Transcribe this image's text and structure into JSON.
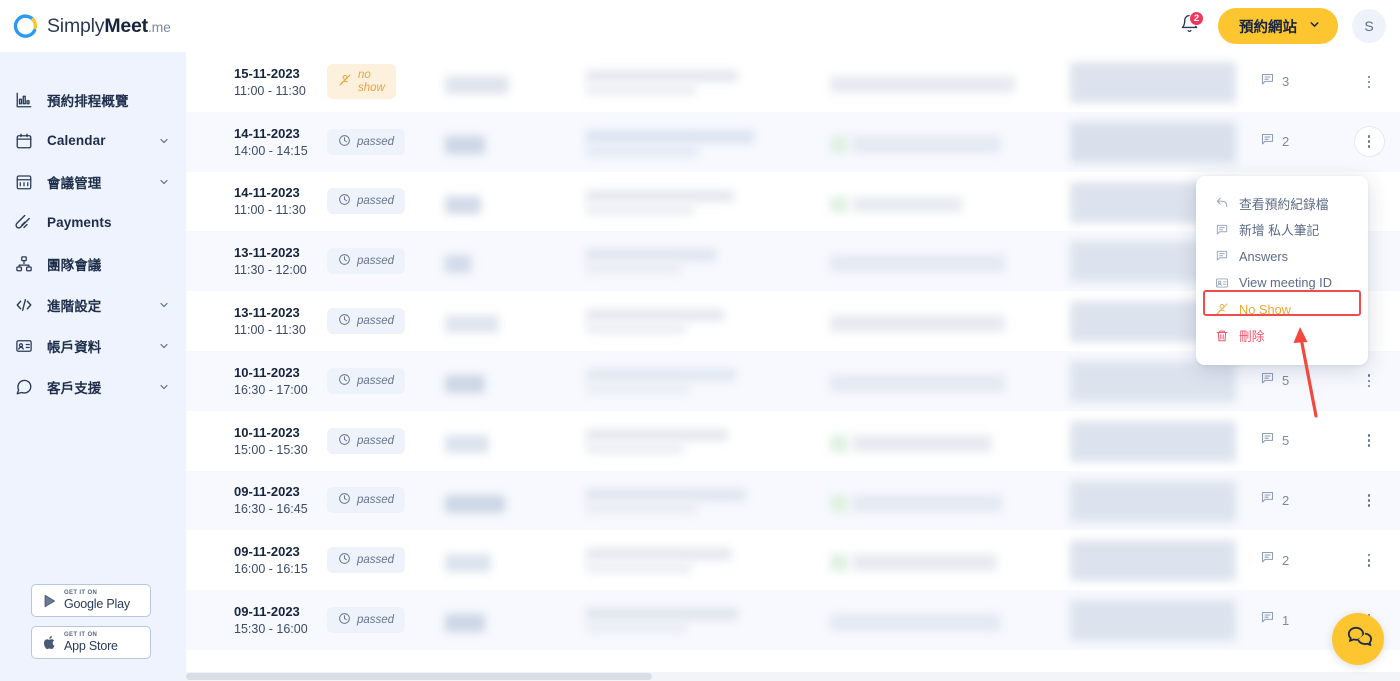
{
  "header": {
    "logo": {
      "simply": "Simply",
      "meet": "Meet",
      "me": ".me",
      "icon": "simplymeet-circle-logo"
    },
    "notifications": {
      "icon": "bell-icon",
      "badge": "2"
    },
    "cta": {
      "label": "預約網站",
      "chevron": "chevron-down-icon"
    },
    "avatar": {
      "initial": "S"
    }
  },
  "sidebar": {
    "items": [
      {
        "label": "預約排程概覽",
        "icon": "chart-bar-icon",
        "chevron": false
      },
      {
        "label": "Calendar",
        "icon": "calendar-icon",
        "chevron": true
      },
      {
        "label": "會議管理",
        "icon": "calendar-grid-icon",
        "chevron": true
      },
      {
        "label": "Payments",
        "icon": "payments-icon",
        "chevron": false
      },
      {
        "label": "團隊會議",
        "icon": "org-chart-icon",
        "chevron": false
      },
      {
        "label": "進階設定",
        "icon": "code-brackets-icon",
        "chevron": true
      },
      {
        "label": "帳戶資料",
        "icon": "id-card-icon",
        "chevron": true
      },
      {
        "label": "客戶支援",
        "icon": "chat-bubble-icon",
        "chevron": true
      }
    ],
    "stores": [
      {
        "top": "GET IT ON",
        "name": "Google Play",
        "icon": "google-play-icon"
      },
      {
        "top": "GET IT ON",
        "name": "App Store",
        "icon": "apple-icon"
      }
    ]
  },
  "table": {
    "rows": [
      {
        "date": "15-11-2023",
        "time": "11:00 - 11:30",
        "status": "no show",
        "status_type": "noshow",
        "comments": "3"
      },
      {
        "date": "14-11-2023",
        "time": "14:00 - 14:15",
        "status": "passed",
        "status_type": "passed",
        "comments": "2"
      },
      {
        "date": "14-11-2023",
        "time": "11:00 - 11:30",
        "status": "passed",
        "status_type": "passed",
        "comments": ""
      },
      {
        "date": "13-11-2023",
        "time": "11:30 - 12:00",
        "status": "passed",
        "status_type": "passed",
        "comments": ""
      },
      {
        "date": "13-11-2023",
        "time": "11:00 - 11:30",
        "status": "passed",
        "status_type": "passed",
        "comments": ""
      },
      {
        "date": "10-11-2023",
        "time": "16:30 - 17:00",
        "status": "passed",
        "status_type": "passed",
        "comments": "5"
      },
      {
        "date": "10-11-2023",
        "time": "15:00 - 15:30",
        "status": "passed",
        "status_type": "passed",
        "comments": "5"
      },
      {
        "date": "09-11-2023",
        "time": "16:30 - 16:45",
        "status": "passed",
        "status_type": "passed",
        "comments": "2"
      },
      {
        "date": "09-11-2023",
        "time": "16:00 - 16:15",
        "status": "passed",
        "status_type": "passed",
        "comments": "2"
      },
      {
        "date": "09-11-2023",
        "time": "15:30 - 16:00",
        "status": "passed",
        "status_type": "passed",
        "comments": "1"
      }
    ],
    "noshow_label_line1": "no",
    "noshow_label_line2": "show",
    "comment_icon": "comment-icon",
    "kebab_icon": "more-vertical-icon"
  },
  "context_menu": {
    "items": [
      {
        "label": "查看預約紀錄檔",
        "icon": "reply-arrow-icon",
        "style": "normal"
      },
      {
        "label": "新增 私人筆記",
        "icon": "comment-icon",
        "style": "normal"
      },
      {
        "label": "Answers",
        "icon": "comment-icon",
        "style": "normal"
      },
      {
        "label": "View meeting ID",
        "icon": "id-card-icon",
        "style": "normal"
      },
      {
        "label": "No Show",
        "icon": "no-show-icon",
        "style": "highlight"
      },
      {
        "label": "刪除",
        "icon": "trash-icon",
        "style": "danger"
      }
    ]
  },
  "annotation": {
    "type": "red-arrow-up",
    "target": "No Show",
    "color": "#f4483f"
  },
  "chat_widget": {
    "icon": "chat-bubbles-icon",
    "color": "#fdc52f"
  },
  "colors": {
    "accent_yellow": "#fdc52f",
    "sidebar_bg": "#eef3fd",
    "text_dark": "#16243d",
    "badge_noshow": "#e8a43a",
    "danger_red": "#f4566f",
    "annotation_red": "#f34b4b"
  }
}
